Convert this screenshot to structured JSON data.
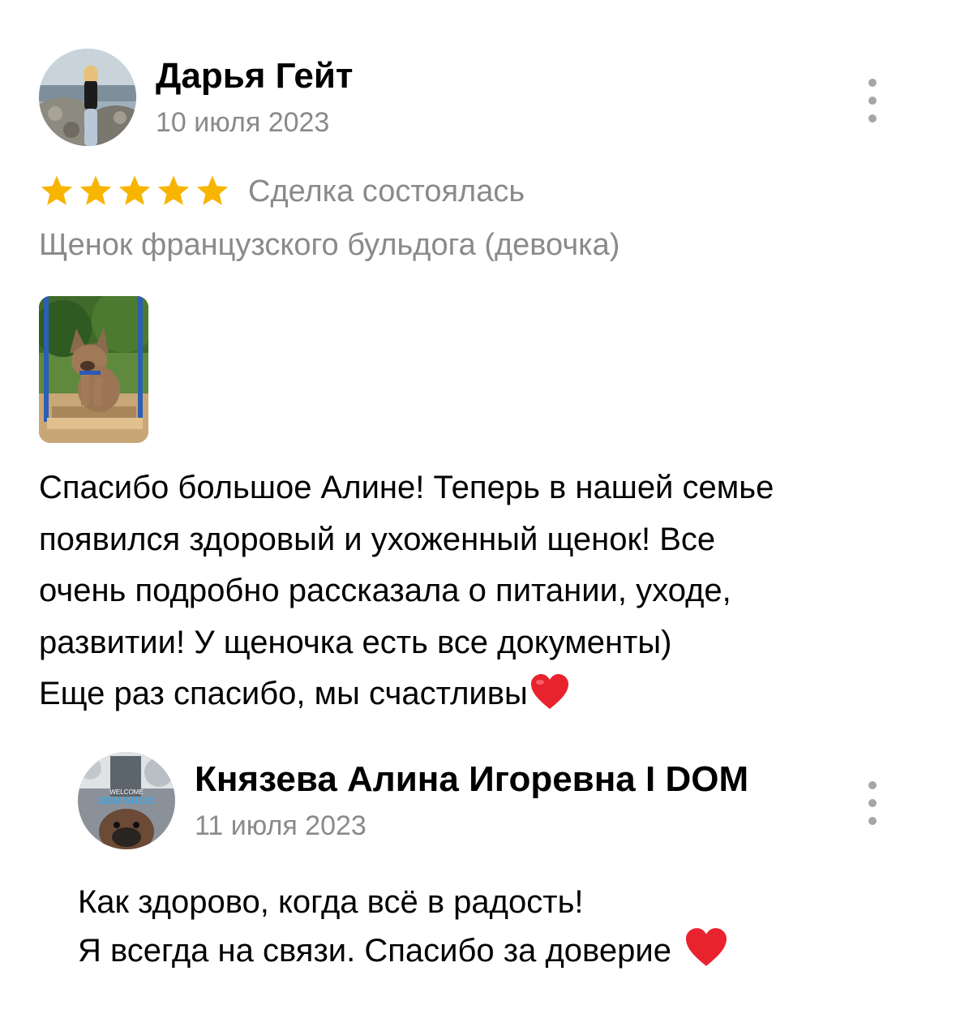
{
  "review": {
    "author_name": "Дарья Гейт",
    "date": "10 июля 2023",
    "rating": 5,
    "rating_max": 5,
    "deal_status": "Сделка состоялась",
    "item_title": "Щенок французского бульдога (девочка)",
    "text_lines": [
      "Спасибо большое Алине! Теперь в нашей семье",
      "появился здоровый и ухоженный щенок! Все",
      "очень подробно рассказала о питании, уходе,",
      "развитии! У щеночка есть все документы)",
      "Еще раз спасибо, мы счастливы"
    ],
    "menu_icon": "more-vertical-icon",
    "star_color": "#f7b500"
  },
  "reply": {
    "author_name": "Князева Алина Игоревна I DOM",
    "date": "11 июля 2023",
    "avatar_text": [
      "WELCOME",
      "DOM GUCCI"
    ],
    "text_lines": [
      "Как здорово, когда всё в радость!",
      "Я всегда на связи. Спасибо за доверие"
    ],
    "menu_icon": "more-vertical-icon"
  },
  "colors": {
    "heart": "#e8232e",
    "secondary_text": "#8a8a8a"
  }
}
